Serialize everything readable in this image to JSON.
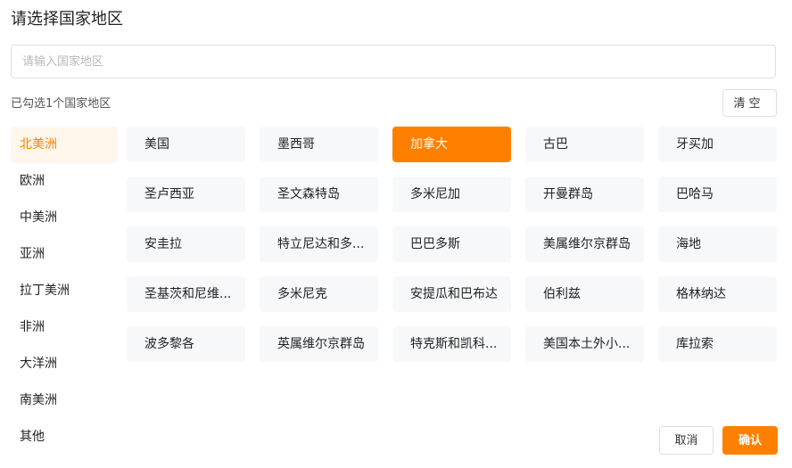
{
  "dialog": {
    "title": "请选择国家地区",
    "search_placeholder": "请输入国家地区",
    "search_value": "",
    "selected_count_text": "已勾选1个国家地区",
    "clear_label": "清空",
    "cancel_label": "取消",
    "confirm_label": "确认"
  },
  "regions": [
    {
      "label": "北美洲",
      "active": true
    },
    {
      "label": "欧洲",
      "active": false
    },
    {
      "label": "中美洲",
      "active": false
    },
    {
      "label": "亚洲",
      "active": false
    },
    {
      "label": "拉丁美洲",
      "active": false
    },
    {
      "label": "非洲",
      "active": false
    },
    {
      "label": "大洋洲",
      "active": false
    },
    {
      "label": "南美洲",
      "active": false
    },
    {
      "label": "其他",
      "active": false
    }
  ],
  "countries": [
    {
      "label": "美国",
      "selected": false
    },
    {
      "label": "墨西哥",
      "selected": false
    },
    {
      "label": "加拿大",
      "selected": true
    },
    {
      "label": "古巴",
      "selected": false
    },
    {
      "label": "牙买加",
      "selected": false
    },
    {
      "label": "圣卢西亚",
      "selected": false
    },
    {
      "label": "圣文森特岛",
      "selected": false
    },
    {
      "label": "多米尼加",
      "selected": false
    },
    {
      "label": "开曼群岛",
      "selected": false
    },
    {
      "label": "巴哈马",
      "selected": false
    },
    {
      "label": "安圭拉",
      "selected": false
    },
    {
      "label": "特立尼达和多...",
      "selected": false
    },
    {
      "label": "巴巴多斯",
      "selected": false
    },
    {
      "label": "美属维尔京群岛",
      "selected": false
    },
    {
      "label": "海地",
      "selected": false
    },
    {
      "label": "圣基茨和尼维...",
      "selected": false
    },
    {
      "label": "多米尼克",
      "selected": false
    },
    {
      "label": "安提瓜和巴布达",
      "selected": false
    },
    {
      "label": "伯利兹",
      "selected": false
    },
    {
      "label": "格林纳达",
      "selected": false
    },
    {
      "label": "波多黎各",
      "selected": false
    },
    {
      "label": "英属维尔京群岛",
      "selected": false
    },
    {
      "label": "特克斯和凯科...",
      "selected": false
    },
    {
      "label": "美国本土外小...",
      "selected": false
    },
    {
      "label": "库拉索",
      "selected": false
    }
  ],
  "colors": {
    "accent": "#ff8000",
    "active_region_bg": "#fff7ec",
    "tile_bg": "#f7f8fa",
    "border": "#dcdfe6"
  }
}
